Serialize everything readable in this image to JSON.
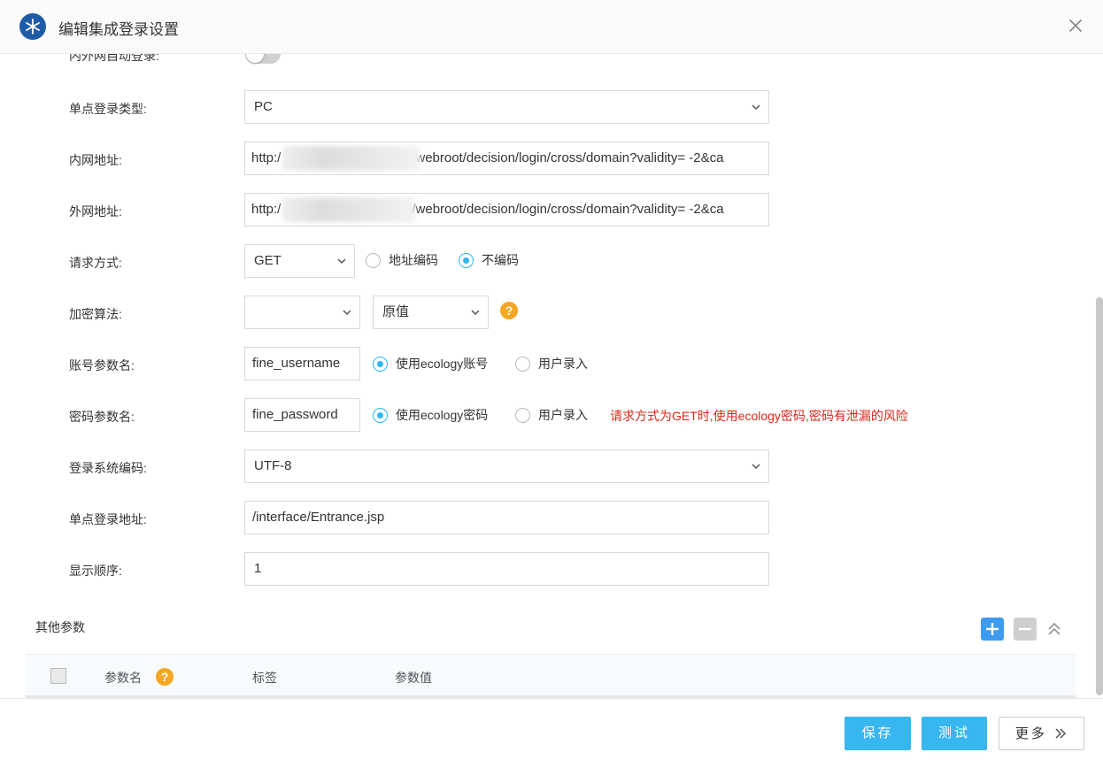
{
  "header": {
    "title": "编辑集成登录设置",
    "logo_icon": "snowflake-icon",
    "close_icon": "close-icon"
  },
  "form": {
    "auto_login_label": "内外网自动登录:",
    "sso_type_label": "单点登录类型:",
    "sso_type_value": "PC",
    "intranet_label": "内网地址:",
    "intranet_prefix": "http:/",
    "intranet_suffix": "webroot/decision/login/cross/domain?validity= -2&ca",
    "extranet_label": "外网地址:",
    "extranet_prefix": "http:/",
    "extranet_suffix": "/webroot/decision/login/cross/domain?validity= -2&ca",
    "method_label": "请求方式:",
    "method_value": "GET",
    "method_options": {
      "encode": "地址编码",
      "no_encode": "不编码",
      "selected": "no_encode"
    },
    "encrypt_label": "加密算法:",
    "encrypt_value": "",
    "encrypt_mode_value": "原值",
    "account_label": "账号参数名:",
    "account_value": "fine_username",
    "account_options": {
      "ecology": "使用ecology账号",
      "user": "用户录入",
      "selected": "ecology"
    },
    "password_label": "密码参数名:",
    "password_value": "fine_password",
    "password_options": {
      "ecology": "使用ecology密码",
      "user": "用户录入",
      "selected": "ecology"
    },
    "password_warning": "请求方式为GET时,使用ecology密码,密码有泄漏的风险",
    "encoding_label": "登录系统编码:",
    "encoding_value": "UTF-8",
    "sso_url_label": "单点登录地址:",
    "sso_url_value": "/interface/Entrance.jsp",
    "order_label": "显示顺序:",
    "order_value": "1"
  },
  "other_params": {
    "title": "其他参数",
    "columns": [
      "参数名",
      "标签",
      "参数值"
    ],
    "help_glyph": "?"
  },
  "footer": {
    "save": "保存",
    "test": "测试",
    "more": "更多"
  },
  "colors": {
    "accent": "#37b6f0",
    "brand": "#1f5ca8",
    "warning": "#e0261a",
    "help": "#f5a623"
  }
}
